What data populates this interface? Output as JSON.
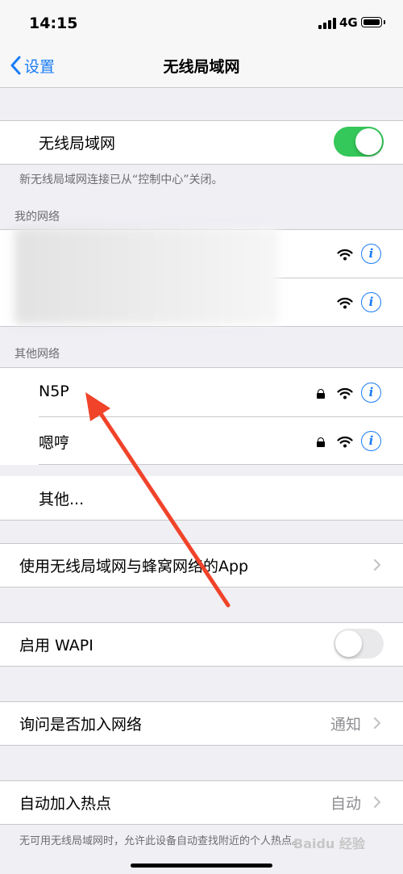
{
  "status_bar": {
    "time": "14:15",
    "network": "4G"
  },
  "nav": {
    "back_label": "设置",
    "title": "无线局域网"
  },
  "wifi_toggle": {
    "label": "无线局域网",
    "on": true
  },
  "wifi_note": "新无线局域网连接已从“控制中心”关闭。",
  "my_networks": {
    "header": "我的网络"
  },
  "other_networks": {
    "header": "其他网络",
    "items": [
      {
        "name": "N5P",
        "locked": true
      },
      {
        "name": "嗯哼",
        "locked": true
      }
    ],
    "other_label": "其他..."
  },
  "apps_row": {
    "label": "使用无线局域网与蜂窝网络的App"
  },
  "wapi": {
    "label": "启用 WAPI",
    "on": false
  },
  "ask_join": {
    "label": "询问是否加入网络",
    "value": "通知"
  },
  "auto_hotspot": {
    "label": "自动加入热点",
    "value": "自动"
  },
  "hotspot_note": "无可用无线局域网时，允许此设备自动查找附近的个人热点。",
  "watermark": "Baidu 经验",
  "colors": {
    "accent": "#1a7cf5",
    "toggle_on": "#34c759",
    "background": "#efeff4"
  }
}
